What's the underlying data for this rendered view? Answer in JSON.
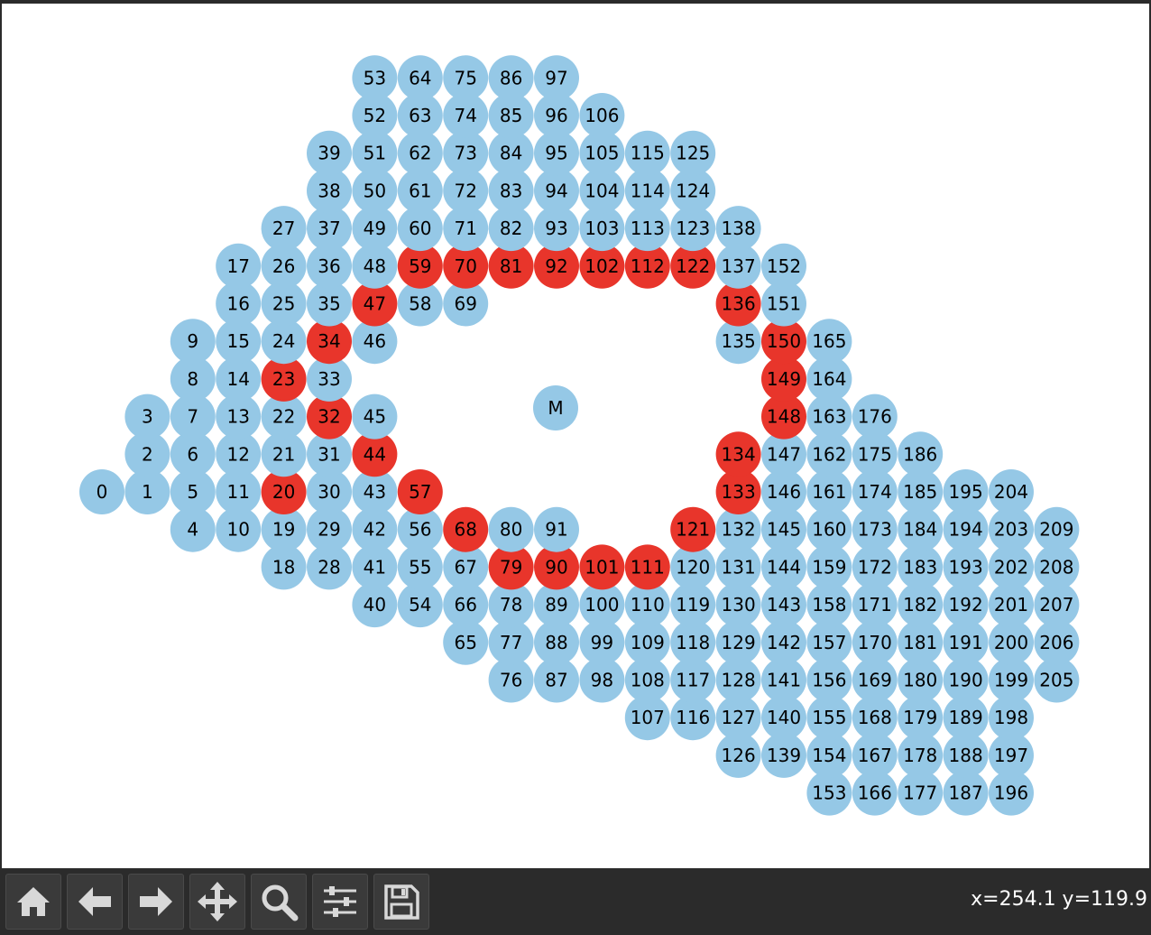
{
  "chart_data": {
    "type": "scatter",
    "title": "",
    "xlabel": "",
    "ylabel": "",
    "grid": false,
    "colors": {
      "normal": "#95c8e6",
      "highlight": "#e8352b"
    },
    "center_label": "M",
    "highlighted_nodes": [
      "20",
      "23",
      "32",
      "34",
      "44",
      "47",
      "57",
      "59",
      "68",
      "70",
      "79",
      "81",
      "90",
      "92",
      "101",
      "102",
      "111",
      "112",
      "121",
      "122",
      "133",
      "134",
      "136",
      "148",
      "149",
      "150"
    ],
    "columns": [
      {
        "col": 0,
        "nodes": [
          {
            "label": "0",
            "row": 0
          }
        ]
      },
      {
        "col": 1,
        "nodes": [
          {
            "label": "1",
            "row": 0
          },
          {
            "label": "2",
            "row": 1
          },
          {
            "label": "3",
            "row": 2
          }
        ]
      },
      {
        "col": 2,
        "nodes": [
          {
            "label": "4",
            "row": -1
          },
          {
            "label": "5",
            "row": 0
          },
          {
            "label": "6",
            "row": 1
          },
          {
            "label": "7",
            "row": 2
          },
          {
            "label": "8",
            "row": 3
          },
          {
            "label": "9",
            "row": 4
          }
        ]
      },
      {
        "col": 3,
        "nodes": [
          {
            "label": "10",
            "row": -1
          },
          {
            "label": "11",
            "row": 0
          },
          {
            "label": "12",
            "row": 1
          },
          {
            "label": "13",
            "row": 2
          },
          {
            "label": "14",
            "row": 3
          },
          {
            "label": "15",
            "row": 4
          },
          {
            "label": "16",
            "row": 5
          },
          {
            "label": "17",
            "row": 6
          }
        ]
      },
      {
        "col": 4,
        "nodes": [
          {
            "label": "18",
            "row": -2
          },
          {
            "label": "19",
            "row": -1
          },
          {
            "label": "20",
            "row": 0
          },
          {
            "label": "21",
            "row": 1
          },
          {
            "label": "22",
            "row": 2
          },
          {
            "label": "23",
            "row": 3
          },
          {
            "label": "24",
            "row": 4
          },
          {
            "label": "25",
            "row": 5
          },
          {
            "label": "26",
            "row": 6
          },
          {
            "label": "27",
            "row": 7
          }
        ]
      },
      {
        "col": 5,
        "nodes": [
          {
            "label": "28",
            "row": -2
          },
          {
            "label": "29",
            "row": -1
          },
          {
            "label": "30",
            "row": 0
          },
          {
            "label": "31",
            "row": 1
          },
          {
            "label": "32",
            "row": 2
          },
          {
            "label": "33",
            "row": 3
          },
          {
            "label": "34",
            "row": 4
          },
          {
            "label": "35",
            "row": 5
          },
          {
            "label": "36",
            "row": 6
          },
          {
            "label": "37",
            "row": 7
          },
          {
            "label": "38",
            "row": 8
          },
          {
            "label": "39",
            "row": 9
          }
        ]
      },
      {
        "col": 6,
        "nodes": [
          {
            "label": "40",
            "row": -3
          },
          {
            "label": "41",
            "row": -2
          },
          {
            "label": "42",
            "row": -1
          },
          {
            "label": "43",
            "row": 0
          },
          {
            "label": "44",
            "row": 1
          },
          {
            "label": "45",
            "row": 2
          },
          {
            "label": "46",
            "row": 4
          },
          {
            "label": "47",
            "row": 5
          },
          {
            "label": "48",
            "row": 6
          },
          {
            "label": "49",
            "row": 7
          },
          {
            "label": "50",
            "row": 8
          },
          {
            "label": "51",
            "row": 9
          },
          {
            "label": "52",
            "row": 10
          },
          {
            "label": "53",
            "row": 11
          }
        ]
      },
      {
        "col": 7,
        "nodes": [
          {
            "label": "54",
            "row": -3
          },
          {
            "label": "55",
            "row": -2
          },
          {
            "label": "56",
            "row": -1
          },
          {
            "label": "57",
            "row": 0
          },
          {
            "label": "58",
            "row": 5
          },
          {
            "label": "59",
            "row": 6
          },
          {
            "label": "60",
            "row": 7
          },
          {
            "label": "61",
            "row": 8
          },
          {
            "label": "62",
            "row": 9
          },
          {
            "label": "63",
            "row": 10
          },
          {
            "label": "64",
            "row": 11
          }
        ]
      },
      {
        "col": 8,
        "nodes": [
          {
            "label": "65",
            "row": -4
          },
          {
            "label": "66",
            "row": -3
          },
          {
            "label": "67",
            "row": -2
          },
          {
            "label": "68",
            "row": -1
          },
          {
            "label": "69",
            "row": 5
          },
          {
            "label": "70",
            "row": 6
          },
          {
            "label": "71",
            "row": 7
          },
          {
            "label": "72",
            "row": 8
          },
          {
            "label": "73",
            "row": 9
          },
          {
            "label": "74",
            "row": 10
          },
          {
            "label": "75",
            "row": 11
          }
        ]
      },
      {
        "col": 9,
        "nodes": [
          {
            "label": "76",
            "row": -5
          },
          {
            "label": "77",
            "row": -4
          },
          {
            "label": "78",
            "row": -3
          },
          {
            "label": "79",
            "row": -2
          },
          {
            "label": "80",
            "row": -1
          },
          {
            "label": "81",
            "row": 6
          },
          {
            "label": "82",
            "row": 7
          },
          {
            "label": "83",
            "row": 8
          },
          {
            "label": "84",
            "row": 9
          },
          {
            "label": "85",
            "row": 10
          },
          {
            "label": "86",
            "row": 11
          }
        ]
      },
      {
        "col": 10,
        "nodes": [
          {
            "label": "87",
            "row": -5
          },
          {
            "label": "88",
            "row": -4
          },
          {
            "label": "89",
            "row": -3
          },
          {
            "label": "90",
            "row": -2
          },
          {
            "label": "91",
            "row": -1
          },
          {
            "label": "92",
            "row": 6
          },
          {
            "label": "93",
            "row": 7
          },
          {
            "label": "94",
            "row": 8
          },
          {
            "label": "95",
            "row": 9
          },
          {
            "label": "96",
            "row": 10
          },
          {
            "label": "97",
            "row": 11
          }
        ]
      },
      {
        "col": 11,
        "nodes": [
          {
            "label": "98",
            "row": -5
          },
          {
            "label": "99",
            "row": -4
          },
          {
            "label": "100",
            "row": -3
          },
          {
            "label": "101",
            "row": -2
          },
          {
            "label": "102",
            "row": 6
          },
          {
            "label": "103",
            "row": 7
          },
          {
            "label": "104",
            "row": 8
          },
          {
            "label": "105",
            "row": 9
          },
          {
            "label": "106",
            "row": 10
          }
        ]
      },
      {
        "col": 12,
        "nodes": [
          {
            "label": "107",
            "row": -6
          },
          {
            "label": "108",
            "row": -5
          },
          {
            "label": "109",
            "row": -4
          },
          {
            "label": "110",
            "row": -3
          },
          {
            "label": "111",
            "row": -2
          },
          {
            "label": "112",
            "row": 6
          },
          {
            "label": "113",
            "row": 7
          },
          {
            "label": "114",
            "row": 8
          },
          {
            "label": "115",
            "row": 9
          }
        ]
      },
      {
        "col": 13,
        "nodes": [
          {
            "label": "116",
            "row": -6
          },
          {
            "label": "117",
            "row": -5
          },
          {
            "label": "118",
            "row": -4
          },
          {
            "label": "119",
            "row": -3
          },
          {
            "label": "120",
            "row": -2
          },
          {
            "label": "121",
            "row": -1
          },
          {
            "label": "122",
            "row": 6
          },
          {
            "label": "123",
            "row": 7
          },
          {
            "label": "124",
            "row": 8
          },
          {
            "label": "125",
            "row": 9
          }
        ]
      },
      {
        "col": 14,
        "nodes": [
          {
            "label": "126",
            "row": -7
          },
          {
            "label": "127",
            "row": -6
          },
          {
            "label": "128",
            "row": -5
          },
          {
            "label": "129",
            "row": -4
          },
          {
            "label": "130",
            "row": -3
          },
          {
            "label": "131",
            "row": -2
          },
          {
            "label": "132",
            "row": -1
          },
          {
            "label": "133",
            "row": 0
          },
          {
            "label": "134",
            "row": 1
          },
          {
            "label": "135",
            "row": 4
          },
          {
            "label": "136",
            "row": 5
          },
          {
            "label": "137",
            "row": 6
          },
          {
            "label": "138",
            "row": 7
          }
        ]
      },
      {
        "col": 15,
        "nodes": [
          {
            "label": "139",
            "row": -7
          },
          {
            "label": "140",
            "row": -6
          },
          {
            "label": "141",
            "row": -5
          },
          {
            "label": "142",
            "row": -4
          },
          {
            "label": "143",
            "row": -3
          },
          {
            "label": "144",
            "row": -2
          },
          {
            "label": "145",
            "row": -1
          },
          {
            "label": "146",
            "row": 0
          },
          {
            "label": "147",
            "row": 1
          },
          {
            "label": "148",
            "row": 2
          },
          {
            "label": "149",
            "row": 3
          },
          {
            "label": "150",
            "row": 4
          },
          {
            "label": "151",
            "row": 5
          },
          {
            "label": "152",
            "row": 6
          }
        ]
      },
      {
        "col": 16,
        "nodes": [
          {
            "label": "153",
            "row": -8
          },
          {
            "label": "154",
            "row": -7
          },
          {
            "label": "155",
            "row": -6
          },
          {
            "label": "156",
            "row": -5
          },
          {
            "label": "157",
            "row": -4
          },
          {
            "label": "158",
            "row": -3
          },
          {
            "label": "159",
            "row": -2
          },
          {
            "label": "160",
            "row": -1
          },
          {
            "label": "161",
            "row": 0
          },
          {
            "label": "162",
            "row": 1
          },
          {
            "label": "163",
            "row": 2
          },
          {
            "label": "164",
            "row": 3
          },
          {
            "label": "165",
            "row": 4
          }
        ]
      },
      {
        "col": 17,
        "nodes": [
          {
            "label": "166",
            "row": -8
          },
          {
            "label": "167",
            "row": -7
          },
          {
            "label": "168",
            "row": -6
          },
          {
            "label": "169",
            "row": -5
          },
          {
            "label": "170",
            "row": -4
          },
          {
            "label": "171",
            "row": -3
          },
          {
            "label": "172",
            "row": -2
          },
          {
            "label": "173",
            "row": -1
          },
          {
            "label": "174",
            "row": 0
          },
          {
            "label": "175",
            "row": 1
          },
          {
            "label": "176",
            "row": 2
          }
        ]
      },
      {
        "col": 18,
        "nodes": [
          {
            "label": "177",
            "row": -8
          },
          {
            "label": "178",
            "row": -7
          },
          {
            "label": "179",
            "row": -6
          },
          {
            "label": "180",
            "row": -5
          },
          {
            "label": "181",
            "row": -4
          },
          {
            "label": "182",
            "row": -3
          },
          {
            "label": "183",
            "row": -2
          },
          {
            "label": "184",
            "row": -1
          },
          {
            "label": "185",
            "row": 0
          },
          {
            "label": "186",
            "row": 1
          }
        ]
      },
      {
        "col": 19,
        "nodes": [
          {
            "label": "187",
            "row": -8
          },
          {
            "label": "188",
            "row": -7
          },
          {
            "label": "189",
            "row": -6
          },
          {
            "label": "190",
            "row": -5
          },
          {
            "label": "191",
            "row": -4
          },
          {
            "label": "192",
            "row": -3
          },
          {
            "label": "193",
            "row": -2
          },
          {
            "label": "194",
            "row": -1
          },
          {
            "label": "195",
            "row": 0
          }
        ]
      },
      {
        "col": 20,
        "nodes": [
          {
            "label": "196",
            "row": -8
          },
          {
            "label": "197",
            "row": -7
          },
          {
            "label": "198",
            "row": -6
          },
          {
            "label": "199",
            "row": -5
          },
          {
            "label": "200",
            "row": -4
          },
          {
            "label": "201",
            "row": -3
          },
          {
            "label": "202",
            "row": -2
          },
          {
            "label": "203",
            "row": -1
          },
          {
            "label": "204",
            "row": 0
          }
        ]
      },
      {
        "col": 21,
        "nodes": [
          {
            "label": "205",
            "row": -5
          },
          {
            "label": "206",
            "row": -4
          },
          {
            "label": "207",
            "row": -3
          },
          {
            "label": "208",
            "row": -2
          },
          {
            "label": "209",
            "row": -1
          }
        ]
      }
    ]
  },
  "toolbar": {
    "buttons": [
      {
        "name": "home-button",
        "icon": "home-icon"
      },
      {
        "name": "back-button",
        "icon": "arrow-left-icon"
      },
      {
        "name": "forward-button",
        "icon": "arrow-right-icon"
      },
      {
        "name": "pan-button",
        "icon": "move-icon"
      },
      {
        "name": "zoom-button",
        "icon": "magnifier-icon"
      },
      {
        "name": "configure-subplots-button",
        "icon": "sliders-icon"
      },
      {
        "name": "save-button",
        "icon": "floppy-disk-icon"
      }
    ],
    "coordinates": "x=254.1 y=119.9"
  }
}
